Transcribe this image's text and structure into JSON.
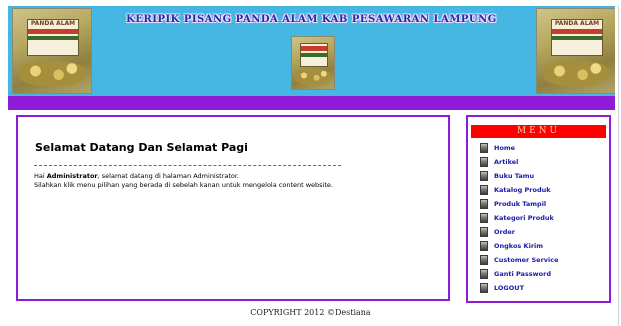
{
  "header": {
    "title": "KERIPIK PISANG PANDA ALAM KAB PESAWARAN LAMPUNG",
    "bg_color": "#46b7e3",
    "images": [
      {
        "name": "product-image-left",
        "label": "PANDA ALAM"
      },
      {
        "name": "product-image-center",
        "label": ""
      },
      {
        "name": "product-image-right",
        "label": "PANDA ALAM"
      }
    ]
  },
  "accent_color": "#8e1bd6",
  "content": {
    "title": "Selamat Datang Dan Selamat Pagi",
    "greeting_prefix": "Hai ",
    "username": "Administrator",
    "greeting_suffix": ", selamat datang di halaman Administrator.",
    "instruction": "Silahkan klik menu pilihan yang berada di sebelah kanan untuk mengelola content website."
  },
  "menu": {
    "title": "MENU",
    "header_color": "#ff0000",
    "items": [
      {
        "label": "Home",
        "icon": "page-icon"
      },
      {
        "label": "Artikel",
        "icon": "page-icon"
      },
      {
        "label": "Buku Tamu",
        "icon": "page-icon"
      },
      {
        "label": "Katalog Produk",
        "icon": "page-icon"
      },
      {
        "label": "Produk Tampil",
        "icon": "page-icon"
      },
      {
        "label": "Kategori Produk",
        "icon": "page-icon"
      },
      {
        "label": "Order",
        "icon": "page-icon"
      },
      {
        "label": "Ongkos Kirim",
        "icon": "page-icon"
      },
      {
        "label": "Customer Service",
        "icon": "page-icon"
      },
      {
        "label": "Ganti Password",
        "icon": "page-icon"
      },
      {
        "label": "LOGOUT",
        "icon": "page-icon"
      }
    ]
  },
  "footer": {
    "copyright": "COPYRIGHT 2012 ©Destiana"
  }
}
